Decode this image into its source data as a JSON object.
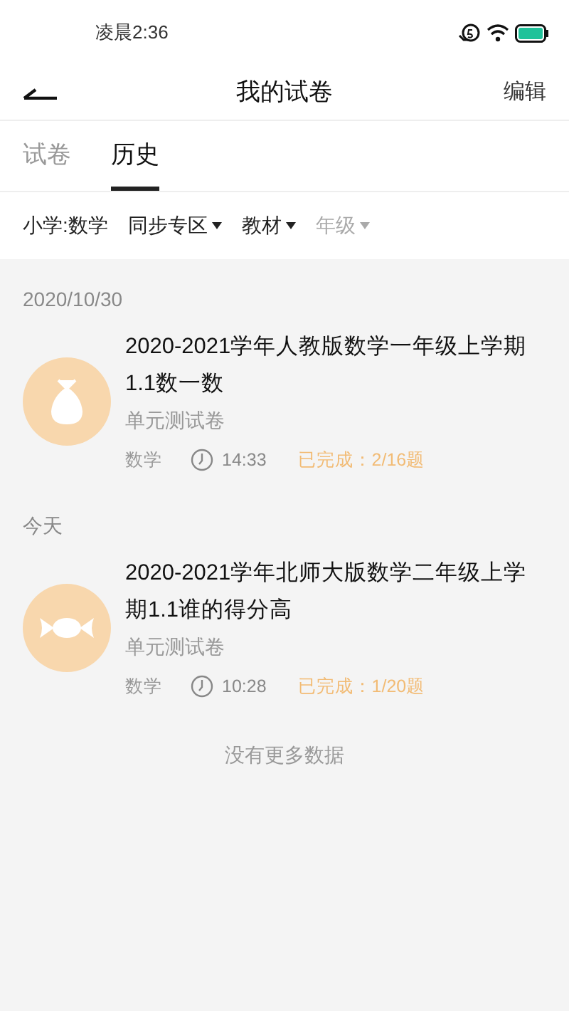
{
  "status_bar": {
    "time": "凌晨2:36"
  },
  "header": {
    "title": "我的试卷",
    "action": "编辑"
  },
  "tabs": [
    {
      "label": "试卷",
      "selected": false
    },
    {
      "label": "历史",
      "selected": true
    }
  ],
  "filters": [
    {
      "kind": "label",
      "label": "小学:数学",
      "disabled": false
    },
    {
      "kind": "dropdown",
      "label": "同步专区",
      "disabled": false
    },
    {
      "kind": "dropdown",
      "label": "教材",
      "disabled": false
    },
    {
      "kind": "dropdown",
      "label": "年级",
      "disabled": true
    }
  ],
  "groups": [
    {
      "date": "2020/10/30",
      "items": [
        {
          "kind": "bag",
          "title": "2020-2021学年人教版数学一年级上学期1.1数一数",
          "subtitle": "单元测试卷",
          "subject": "数学",
          "time": "14:33",
          "progress": "已完成：2/16题"
        }
      ]
    },
    {
      "date": "今天",
      "items": [
        {
          "kind": "candy",
          "title": "2020-2021学年北师大版数学二年级上学期1.1谁的得分高",
          "subtitle": "单元测试卷",
          "subject": "数学",
          "time": "10:28",
          "progress": "已完成：1/20题"
        }
      ]
    }
  ],
  "footer": "没有更多数据"
}
